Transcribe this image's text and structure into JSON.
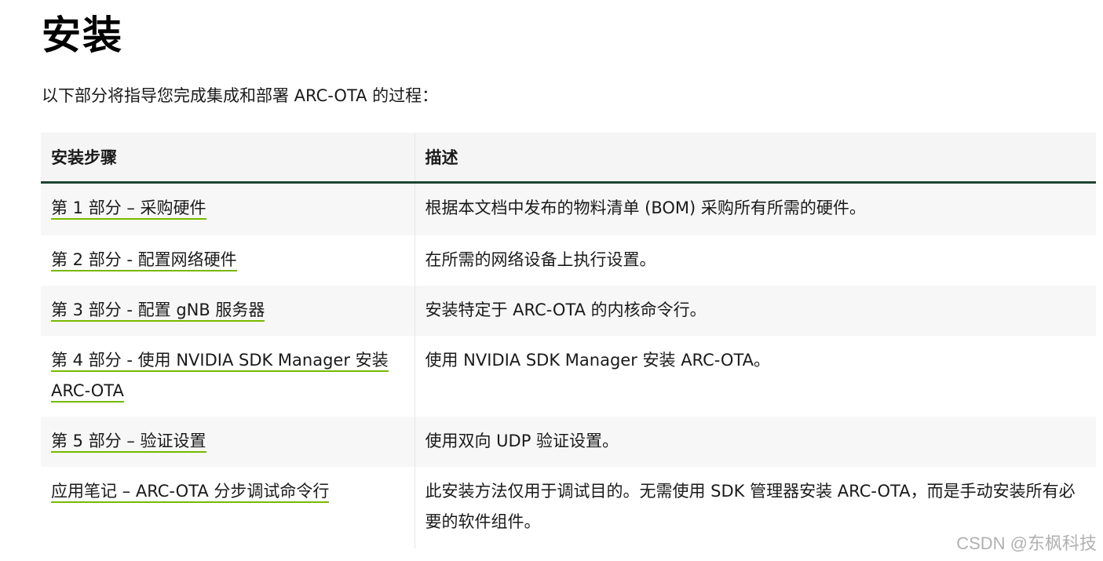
{
  "heading": "安装",
  "intro": "以下部分将指导您完成集成和部署 ARC-OTA 的过程：",
  "table": {
    "headers": [
      "安装步骤",
      "描述"
    ],
    "rows": [
      {
        "step": "第 1 部分 – 采购硬件",
        "description": "根据本文档中发布的物料清单 (BOM) 采购所有所需的硬件。"
      },
      {
        "step": "第 2 部分 - 配置网络硬件",
        "description": "在所需的网络设备上执行设置。"
      },
      {
        "step": "第 3 部分 - 配置 gNB 服务器",
        "description": "安装特定于 ARC-OTA 的内核命令行。"
      },
      {
        "step": "第 4 部分 - 使用 NVIDIA SDK Manager 安装 ARC-OTA",
        "description": "使用 NVIDIA SDK Manager 安装 ARC-OTA。"
      },
      {
        "step": "第 5 部分 – 验证设置",
        "description": "使用双向 UDP 验证设置。"
      },
      {
        "step": "应用笔记 – ARC-OTA 分步调试命令行",
        "description": "此安装方法仅用于调试目的。无需使用 SDK 管理器安装 ARC-OTA，而是手动安装所有必要的软件组件。"
      }
    ]
  },
  "watermark": "CSDN @东枫科技",
  "colors": {
    "link_underline": "#76b900",
    "header_rule": "#1c4532"
  }
}
